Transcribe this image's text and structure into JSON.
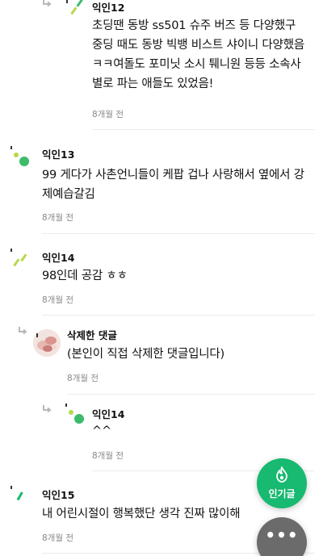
{
  "comments": [
    {
      "author": "익인12",
      "lines": [
        "초딩땐 동방 ss501 슈주 버즈 등 다양했구",
        "중딩 때도 동방 빅뱅 비스트 샤이니 다양했음",
        "ㅋㅋ여돌도 포미닛 소시 퉤니원 등등 소속사",
        "별로 파는 애들도 있었음!"
      ],
      "time": "8개월 전"
    },
    {
      "author": "익인13",
      "lines": [
        "99 게다가 사촌언니들이 케팝 겁나 사랑해서 옆에서 강",
        "제예습갈김"
      ],
      "time": "8개월 전"
    },
    {
      "author": "익인14",
      "lines": [
        "98인데 공감 ㅎㅎ"
      ],
      "time": "8개월 전"
    },
    {
      "author": "삭제한 댓글",
      "lines": [
        "(본인이 직접 삭제한 댓글입니다)"
      ],
      "time": "8개월 전"
    },
    {
      "author": "익인14",
      "lines": [
        "^^"
      ],
      "time": "8개월 전"
    },
    {
      "author": "익인15",
      "lines": [
        "내 어린시절이 행복했단 생각 진짜 많이해"
      ],
      "time": "8개월 전"
    }
  ],
  "fab": {
    "popular_label": "인기글",
    "more_label": "•••"
  },
  "icons": {
    "reply": "reply-arrow-icon",
    "fire": "fire-icon",
    "more": "more-dots-icon"
  },
  "colors": {
    "accent_green": "#18b970",
    "avatar_yellow_green": "#b7d84b",
    "avatar_green": "#3dbb6b"
  }
}
